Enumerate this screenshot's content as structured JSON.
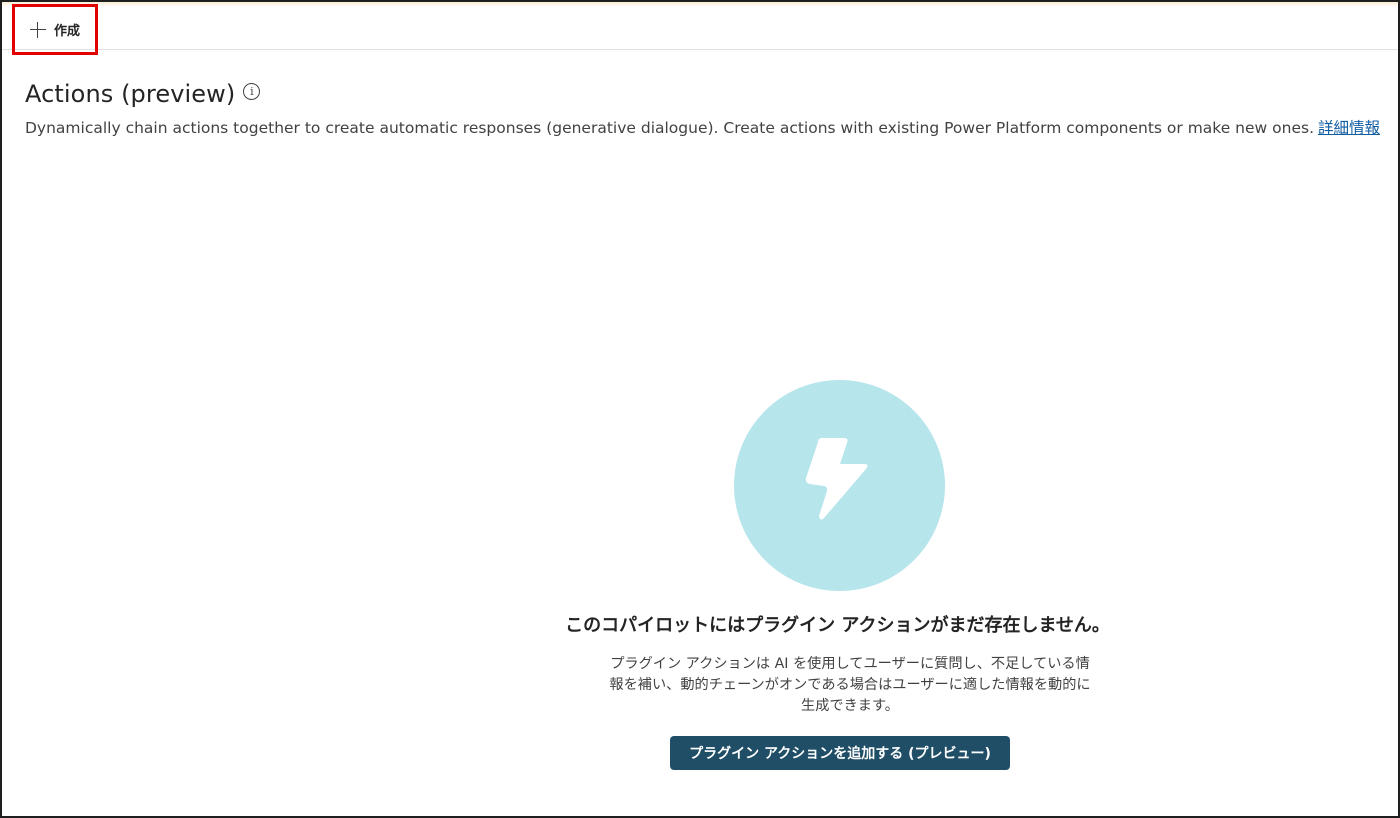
{
  "toolbar": {
    "create_label": "作成"
  },
  "header": {
    "title": "Actions (preview)",
    "info_icon": "info-icon",
    "description": "Dynamically chain actions together to create automatic responses (generative dialogue). Create actions with existing Power Platform components or make new ones.",
    "learn_more": "詳細情報"
  },
  "empty_state": {
    "icon": "lightning-icon",
    "title": "このコパイロットにはプラグイン アクションがまだ存在しません。",
    "description_line1": "プラグイン アクションは AI を使用してユーザーに質問し、不足している情",
    "description_line2": "報を補い、動的チェーンがオンである場合はユーザーに適した情報を動的に",
    "description_line3": "生成できます。",
    "button_label": "プラグイン アクションを追加する (プレビュー)"
  },
  "colors": {
    "circle": "#b6e5ec",
    "button": "#1f4e66",
    "link": "#115ea3",
    "highlight": "#e30000"
  }
}
